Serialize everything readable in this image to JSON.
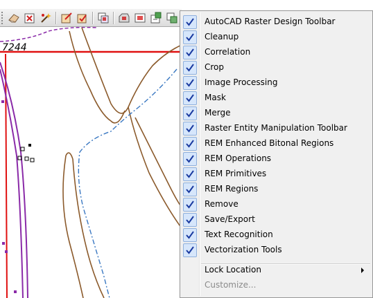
{
  "map": {
    "parcel_label": "7244",
    "colors": {
      "contour": "#8b5a2b",
      "stream": "#3a78c2",
      "parcel": "#e01010",
      "boundary": "#8a2aa8"
    }
  },
  "toolbar": {
    "buttons": [
      "eraser-icon",
      "delete-icon",
      "sparkle-tool-icon",
      "edit-box-icon",
      "check-edit-icon",
      "layers-icon",
      "clip-icon",
      "frame-icon",
      "paste-image-icon",
      "insert-image-icon"
    ]
  },
  "context_menu": {
    "items": [
      {
        "label": "AutoCAD Raster Design Toolbar",
        "checked": true
      },
      {
        "label": "Cleanup",
        "checked": true
      },
      {
        "label": "Correlation",
        "checked": true
      },
      {
        "label": "Crop",
        "checked": true
      },
      {
        "label": "Image Processing",
        "checked": true
      },
      {
        "label": "Mask",
        "checked": true
      },
      {
        "label": "Merge",
        "checked": true
      },
      {
        "label": "Raster Entity Manipulation Toolbar",
        "checked": true
      },
      {
        "label": "REM Enhanced Bitonal Regions",
        "checked": true
      },
      {
        "label": "REM Operations",
        "checked": true
      },
      {
        "label": "REM Primitives",
        "checked": true
      },
      {
        "label": "REM Regions",
        "checked": true
      },
      {
        "label": "Remove",
        "checked": true
      },
      {
        "label": "Save/Export",
        "checked": true
      },
      {
        "label": "Text Recognition",
        "checked": true
      },
      {
        "label": "Vectorization Tools",
        "checked": true
      }
    ],
    "lock_location": "Lock Location",
    "customize": "Customize..."
  }
}
